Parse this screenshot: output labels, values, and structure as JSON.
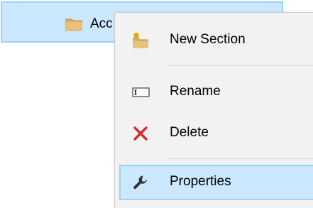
{
  "tree": {
    "selected_item_label": "Acc",
    "selected_item_icon": "folder-icon"
  },
  "context_menu": {
    "items": [
      {
        "label": "New Section",
        "icon": "new-section-folder-icon"
      },
      {
        "label": "Rename",
        "icon": "rename-icon"
      },
      {
        "label": "Delete",
        "icon": "delete-x-icon"
      },
      {
        "label": "Properties",
        "icon": "wrench-icon"
      }
    ],
    "highlighted_item": "Properties"
  },
  "colors": {
    "selection_fill": "#cce8ff",
    "selection_border": "#99d1ff",
    "menu_background": "#f2f2f2",
    "delete_icon": "#d42b2b",
    "folder": "#dcb060"
  }
}
